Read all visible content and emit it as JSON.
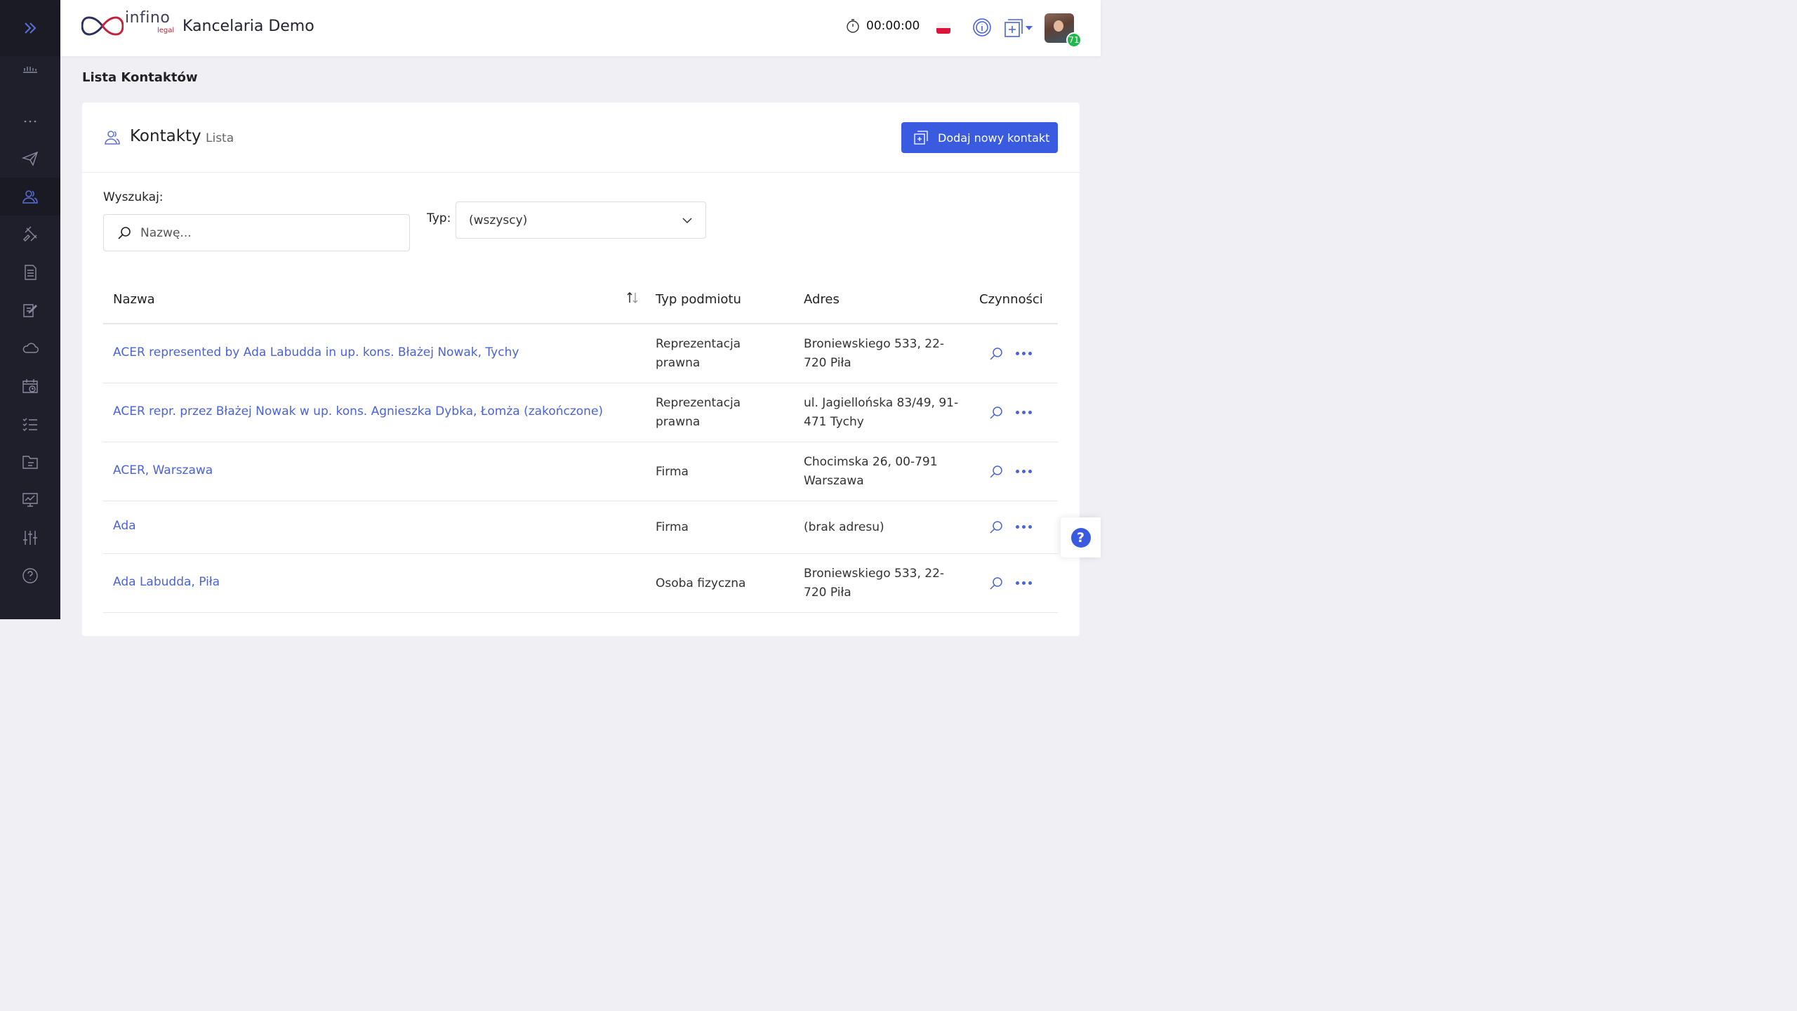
{
  "header": {
    "logo_text": "infino",
    "logo_sub": "legal",
    "app_title": "Kancelaria Demo",
    "timer": "00:00:00",
    "notifications_count": "71"
  },
  "page": {
    "title": "Lista Kontaktów"
  },
  "card": {
    "title": "Kontakty",
    "subtitle": "Lista",
    "add_button": "Dodaj nowy kontakt"
  },
  "filters": {
    "search_label": "Wyszukaj:",
    "search_placeholder": "Nazwę...",
    "search_value": "",
    "type_label": "Typ:",
    "type_selected": "(wszyscy)"
  },
  "table": {
    "columns": [
      "Nazwa",
      "Typ podmiotu",
      "Adres",
      "Czynności"
    ],
    "rows": [
      {
        "name": "ACER represented by Ada Labudda in up. kons. Błażej Nowak, Tychy",
        "type_l1": "Reprezentacja",
        "type_l2": "prawna",
        "addr_l1": "Broniewskiego 533, 22-",
        "addr_l2": "720 Piła"
      },
      {
        "name": "ACER repr. przez Błażej Nowak w up. kons. Agnieszka Dybka, Łomża (zakończone)",
        "type_l1": "Reprezentacja",
        "type_l2": "prawna",
        "addr_l1": "ul. Jagiellońska 83/49, 91-",
        "addr_l2": "471 Tychy"
      },
      {
        "name": "ACER, Warszawa",
        "type_l1": "Firma",
        "type_l2": "",
        "addr_l1": "Chocimska 26, 00-791",
        "addr_l2": "Warszawa"
      },
      {
        "name": "Ada",
        "type_l1": "Firma",
        "type_l2": "",
        "addr_l1": "(brak adresu)",
        "addr_l2": ""
      },
      {
        "name": "Ada Labudda, Piła",
        "type_l1": "Osoba fizyczna",
        "type_l2": "",
        "addr_l1": "Broniewskiego 533, 22-",
        "addr_l2": "720 Piła"
      }
    ]
  },
  "help": {
    "symbol": "?"
  },
  "colors": {
    "sidebar_bg": "#1f1f2b",
    "accent": "#3a5be0",
    "link": "#4a63d8",
    "badge": "#22b84f"
  }
}
